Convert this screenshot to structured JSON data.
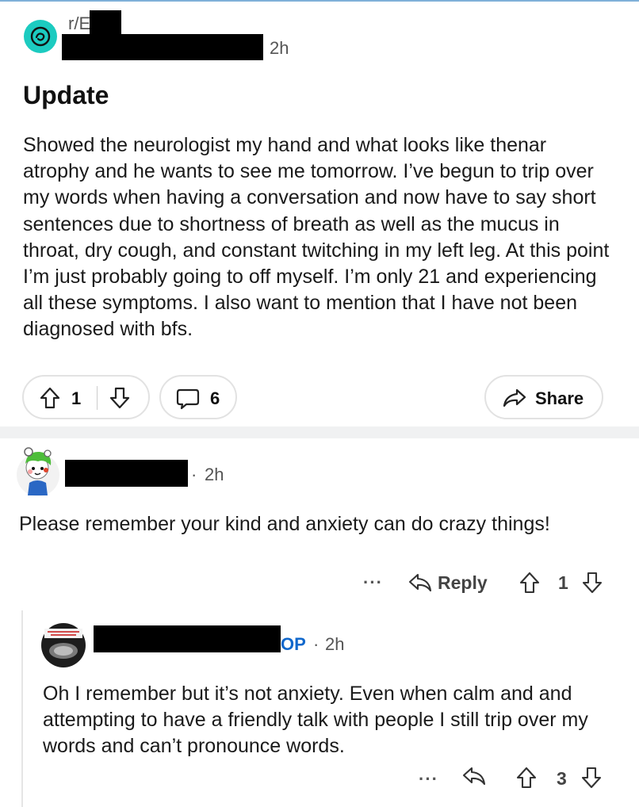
{
  "post": {
    "subreddit_prefix": "r/E",
    "time": "2h",
    "title": "Update",
    "body": "Showed the neurologist my hand and what looks like thenar atrophy and he wants to see me tomorrow. I’ve begun to trip over my words when having a conversation and now have to say short sentences due to shortness of breath as well as the mucus in throat, dry cough, and constant twitching in my left leg. At this point I’m just probably going to off myself. I’m only 21 and experiencing all these symptoms. I also want to mention that I have not been diagnosed with bfs.",
    "vote_count": "1",
    "comment_count": "6",
    "share_label": "Share"
  },
  "comments": [
    {
      "separator": "·",
      "time": "2h",
      "text": "Please remember your kind and anxiety can do crazy things!",
      "more_label": "···",
      "reply_label": "Reply",
      "vote_count": "1"
    },
    {
      "op_label": "OP",
      "separator": "·",
      "time": "2h",
      "text": "Oh I remember but it’s not anxiety. Even when calm and and attempting to have a friendly talk with people I still trip over my words and can’t pronounce words.",
      "more_label": "···",
      "vote_count": "3"
    }
  ],
  "icons": {
    "subreddit": "subreddit-avatar-icon",
    "upvote": "arrow-up-icon",
    "downvote": "arrow-down-icon",
    "comment": "comment-bubble-icon",
    "share": "share-arrow-icon",
    "reply": "reply-arrow-icon"
  },
  "colors": {
    "subreddit_avatar": "#1ccbc0",
    "op_label": "#1168cc",
    "divider": "#f0f1f2"
  }
}
